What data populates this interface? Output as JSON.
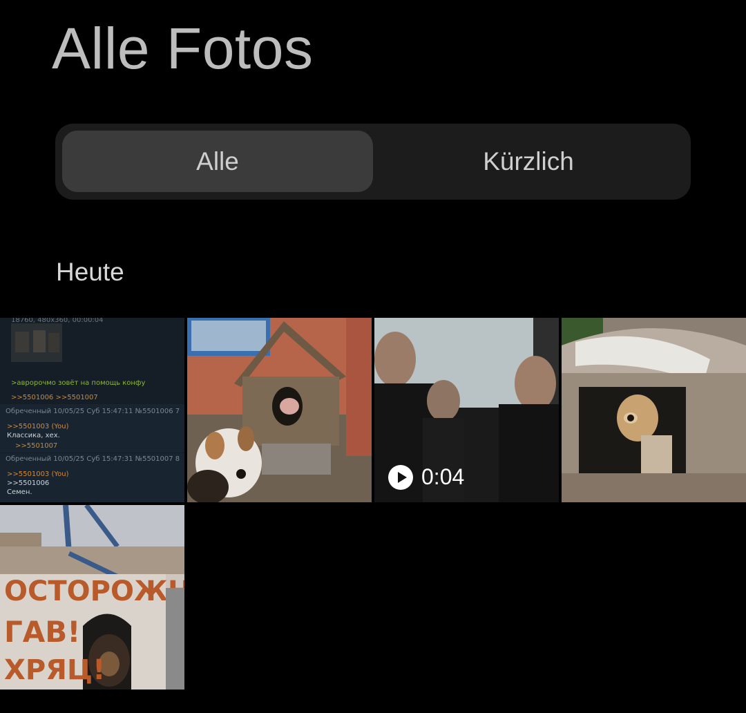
{
  "header": {
    "title": "Alle Fotos"
  },
  "filter": {
    "tabs": [
      {
        "label": "Alle",
        "selected": true
      },
      {
        "label": "Kürzlich",
        "selected": false
      }
    ]
  },
  "sections": [
    {
      "label": "Heute",
      "items": [
        {
          "kind": "screenshot",
          "lines": [
            "18760, 480x360, 00:00:04",
            ">авророчмо зовёт на помощь конфу",
            ">>5501006 >>5501007",
            "Обреченный 10/05/25 Суб 15:47:11 №5501006 7",
            ">>5501003 (You)",
            "Классика, хех.",
            ">>5501007",
            "Обреченный 10/05/25 Суб 15:47:31 №5501007 8",
            ">>5501003 (You)",
            ">>5501006",
            "Семен."
          ]
        },
        {
          "kind": "photo"
        },
        {
          "kind": "video",
          "duration": "0:04"
        },
        {
          "kind": "photo"
        },
        {
          "kind": "photo",
          "painted_text": [
            "ОСТОРОЖНО",
            "ГАВ!",
            "ХРЯЦ!"
          ]
        }
      ]
    }
  ],
  "colors": {
    "background": "#000000",
    "segment_bg": "#1c1c1c",
    "segment_selected": "#3b3b3b"
  }
}
